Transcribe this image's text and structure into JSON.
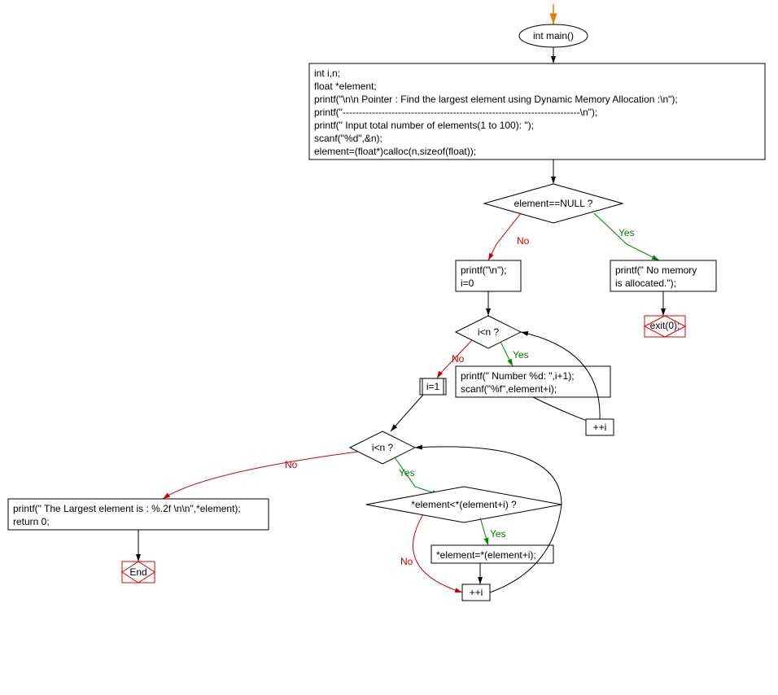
{
  "chart_data": {
    "type": "flowchart",
    "entry": "start_arrow",
    "nodes": [
      {
        "id": "main",
        "kind": "function-entry",
        "label": "int main()"
      },
      {
        "id": "init_block",
        "kind": "process",
        "lines": [
          "int i,n;",
          "float *element;",
          "printf(\"\\n\\n Pointer : Find the largest element using Dynamic Memory Allocation :\\n\");",
          "printf(\"-------------------------------------------------------------------------\\n\");",
          "printf(\" Input total number of elements(1 to 100): \");",
          "scanf(\"%d\",&n);",
          "element=(float*)calloc(n,sizeof(float));"
        ]
      },
      {
        "id": "cond_null",
        "kind": "decision",
        "label": "element==NULL ?"
      },
      {
        "id": "no_mem",
        "kind": "process",
        "lines": [
          "printf(\" No memory",
          "is allocated.\");"
        ]
      },
      {
        "id": "exit0",
        "kind": "terminal",
        "label": "exit(0);"
      },
      {
        "id": "clear_print",
        "kind": "process",
        "lines": [
          "printf(\"\\n\");",
          "i=0"
        ]
      },
      {
        "id": "cond_loop1",
        "kind": "decision",
        "label": "i<n ?"
      },
      {
        "id": "read_elem",
        "kind": "process",
        "lines": [
          "printf(\" Number %d: \",i+1);",
          "scanf(\"%f\",element+i);"
        ]
      },
      {
        "id": "inc1",
        "kind": "process",
        "lines": [
          "++i"
        ]
      },
      {
        "id": "i_eq_1",
        "kind": "process",
        "lines": [
          "i=1"
        ]
      },
      {
        "id": "cond_loop2",
        "kind": "decision",
        "label": "i<n ?"
      },
      {
        "id": "cond_cmp",
        "kind": "decision",
        "label": "*element<*(element+i) ?"
      },
      {
        "id": "assign_max",
        "kind": "process",
        "lines": [
          "*element=*(element+i);"
        ]
      },
      {
        "id": "inc2",
        "kind": "process",
        "lines": [
          "++i"
        ]
      },
      {
        "id": "print_largest",
        "kind": "process",
        "lines": [
          "printf(\" The Largest element is :  %.2f \\n\\n\",*element);",
          "return 0;"
        ]
      },
      {
        "id": "end",
        "kind": "terminal",
        "label": "End"
      }
    ],
    "edges": [
      {
        "from": "start_arrow",
        "to": "main"
      },
      {
        "from": "main",
        "to": "init_block"
      },
      {
        "from": "init_block",
        "to": "cond_null"
      },
      {
        "from": "cond_null",
        "to": "no_mem",
        "label": "Yes"
      },
      {
        "from": "cond_null",
        "to": "clear_print",
        "label": "No"
      },
      {
        "from": "no_mem",
        "to": "exit0"
      },
      {
        "from": "clear_print",
        "to": "cond_loop1"
      },
      {
        "from": "cond_loop1",
        "to": "read_elem",
        "label": "Yes"
      },
      {
        "from": "read_elem",
        "to": "inc1"
      },
      {
        "from": "inc1",
        "to": "cond_loop1"
      },
      {
        "from": "cond_loop1",
        "to": "i_eq_1",
        "label": "No"
      },
      {
        "from": "i_eq_1",
        "to": "cond_loop2"
      },
      {
        "from": "cond_loop2",
        "to": "cond_cmp",
        "label": "Yes"
      },
      {
        "from": "cond_cmp",
        "to": "assign_max",
        "label": "Yes"
      },
      {
        "from": "cond_cmp",
        "to": "inc2",
        "label": "No"
      },
      {
        "from": "assign_max",
        "to": "inc2"
      },
      {
        "from": "inc2",
        "to": "cond_loop2"
      },
      {
        "from": "cond_loop2",
        "to": "print_largest",
        "label": "No"
      },
      {
        "from": "print_largest",
        "to": "end"
      }
    ]
  },
  "nodes": {
    "main": "int main()",
    "init_block": {
      "l1": "int i,n;",
      "l2": "float *element;",
      "l3": "printf(\"\\n\\n Pointer : Find the largest element using Dynamic Memory Allocation :\\n\");",
      "l4": "printf(\"-------------------------------------------------------------------------\\n\");",
      "l5": "printf(\" Input total number of elements(1 to 100): \");",
      "l6": "scanf(\"%d\",&n);",
      "l7": "element=(float*)calloc(n,sizeof(float));"
    },
    "cond_null": "element==NULL ?",
    "no_mem": {
      "l1": "printf(\" No memory",
      "l2": "is allocated.\");"
    },
    "exit0": "exit(0);",
    "clear_print": {
      "l1": "printf(\"\\n\");",
      "l2": "i=0"
    },
    "cond_loop1": "i<n ?",
    "read_elem": {
      "l1": "printf(\" Number %d: \",i+1);",
      "l2": "scanf(\"%f\",element+i);"
    },
    "inc1": "++i",
    "i_eq_1": "i=1",
    "cond_loop2": "i<n ?",
    "cond_cmp": "*element<*(element+i) ?",
    "assign_max": "*element=*(element+i);",
    "inc2": "++i",
    "print_largest": {
      "l1": "printf(\" The Largest element is :  %.2f \\n\\n\",*element);",
      "l2": "return 0;"
    },
    "end": "End"
  },
  "labels": {
    "yes": "Yes",
    "no": "No"
  }
}
